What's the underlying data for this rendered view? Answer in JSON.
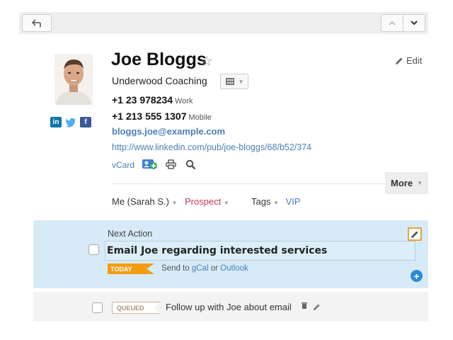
{
  "toolbar": {
    "back_icon": "back-arrow-icon",
    "up_icon": "chevron-up-icon",
    "down_icon": "chevron-down-icon"
  },
  "contact": {
    "name": "Joe Bloggs",
    "company": "Underwood Coaching",
    "phones": [
      {
        "number": "+1 23 978234",
        "type": "Work"
      },
      {
        "number": "+1 213 555 1307",
        "type": "Mobile"
      }
    ],
    "email": "bloggs.joe@example.com",
    "url": "http://www.linkedin.com/pub/joe-bloggs/68/b52/374",
    "vcard_label": "vCard",
    "edit_label": "Edit",
    "more_label": "More"
  },
  "meta": {
    "owner": "Me (Sarah S.)",
    "status": "Prospect",
    "tags_label": "Tags",
    "tag": "VIP"
  },
  "next_action": {
    "label": "Next Action",
    "text": "Email Joe regarding interested services",
    "badge": "TODAY",
    "send_prefix": "Send to",
    "gcal": "gCal",
    "or": "or",
    "outlook": "Outlook"
  },
  "queued": {
    "badge": "QUEUED",
    "text": "Follow up with Joe about email"
  },
  "colors": {
    "link": "#4a7fb5",
    "prospect": "#c0395a",
    "today_badge": "#f39c12",
    "action_panel": "#d6ebf7"
  }
}
